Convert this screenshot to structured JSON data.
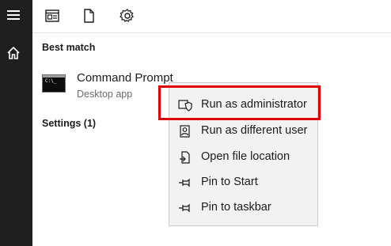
{
  "rail": {
    "menu_icon": "hamburger-icon",
    "home_icon": "home-icon"
  },
  "toolbar": {
    "icons": [
      "apps-icon",
      "document-icon",
      "gear-icon"
    ]
  },
  "sections": {
    "best_match": "Best match",
    "settings": "Settings (1)"
  },
  "result": {
    "title": "Command Prompt",
    "subtitle": "Desktop app",
    "icon": "command-prompt-icon",
    "icon_text": "C:\\_"
  },
  "context_menu": {
    "items": [
      {
        "label": "Run as administrator",
        "icon": "shield-icon"
      },
      {
        "label": "Run as different user",
        "icon": "user-icon"
      },
      {
        "label": "Open file location",
        "icon": "file-location-icon"
      },
      {
        "label": "Pin to Start",
        "icon": "pin-icon"
      },
      {
        "label": "Pin to taskbar",
        "icon": "pin-icon"
      }
    ]
  },
  "colors": {
    "rail": "#1f1f1f",
    "menu_bg": "#f2f2f2",
    "highlight": "#e00000"
  }
}
